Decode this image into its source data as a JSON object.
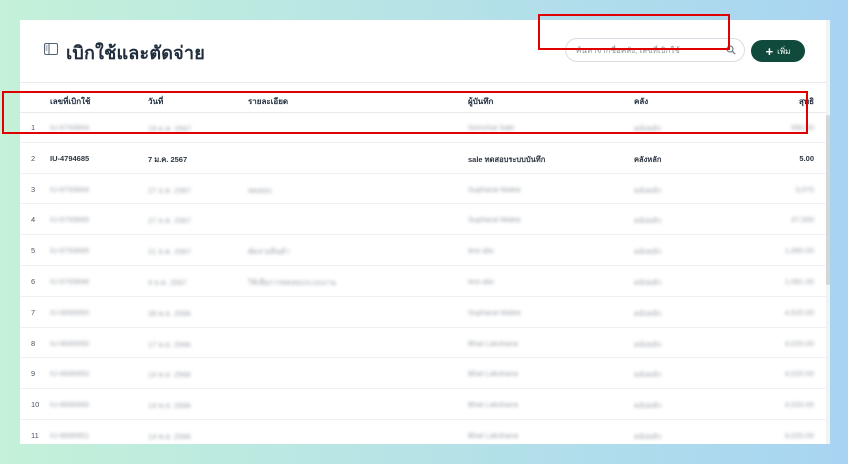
{
  "page": {
    "title": "เบิกใช้และตัดจ่าย",
    "add_label": "เพิ่ม"
  },
  "search": {
    "placeholder": "ค้นหาจากชื่อคลัง, เลขที่เบิกใช้",
    "value": ""
  },
  "table": {
    "columns": [
      "เลขที่เบิกใช้",
      "วันที่",
      "รายละเอียด",
      "ผู้บันทึก",
      "คลัง",
      "สุทธิ"
    ],
    "rows": [
      {
        "num": "1",
        "doc": "IU-6793664",
        "date": "19 ม.ค. 2567",
        "detail": "",
        "recorder": "Somchai Sale",
        "warehouse": "คลังหลัก",
        "net": "990.00"
      },
      {
        "num": "2",
        "doc": "IU-4794685",
        "date": "7 ม.ค. 2567",
        "detail": "",
        "recorder": "sale ทดสอบระบบบันทึก",
        "warehouse": "คลังหลัก",
        "net": "5.00"
      },
      {
        "num": "3",
        "doc": "IU-6793664",
        "date": "27 ธ.ค. 2567",
        "detail": "ทดสอบ",
        "recorder": "Supharat Malee",
        "warehouse": "คลังหลัก",
        "net": "3,070"
      },
      {
        "num": "4",
        "doc": "IU-6793665",
        "date": "27 ธ.ค. 2567",
        "detail": "",
        "recorder": "Supharat Malee",
        "warehouse": "คลังหลัก",
        "net": "37,000"
      },
      {
        "num": "5",
        "doc": "IU-6793665",
        "date": "21 ธ.ค. 2567",
        "detail": "ตัดจ่ายสินค้า",
        "recorder": "test abc",
        "warehouse": "คลังหลัก",
        "net": "1,060.00"
      },
      {
        "num": "6",
        "doc": "IU-6793666",
        "date": "9 ธ.ค. 2567",
        "detail": "ใช้เพื่อการทดสอบระบบงาน",
        "recorder": "test abc",
        "warehouse": "คลังหลัก",
        "net": "1,081.00"
      },
      {
        "num": "7",
        "doc": "IU-6695950",
        "date": "28 พ.ย. 2566",
        "detail": "",
        "recorder": "Supharat Malee",
        "warehouse": "คลังหลัก",
        "net": "4,620.00"
      },
      {
        "num": "8",
        "doc": "IU-6695950",
        "date": "17 พ.ย. 2566",
        "detail": "",
        "recorder": "Bhat Lakshana",
        "warehouse": "คลังหลัก",
        "net": "4,020.00"
      },
      {
        "num": "9",
        "doc": "IU-6695950",
        "date": "14 พ.ย. 2566",
        "detail": "",
        "recorder": "Bhat Lakshana",
        "warehouse": "คลังหลัก",
        "net": "4,020.00"
      },
      {
        "num": "10",
        "doc": "IU-6695950",
        "date": "14 พ.ย. 2566",
        "detail": "",
        "recorder": "Bhat Lakshana",
        "warehouse": "คลังหลัก",
        "net": "4,020.00"
      },
      {
        "num": "11",
        "doc": "IU-6695951",
        "date": "14 พ.ย. 2566",
        "detail": "",
        "recorder": "Bhat Lakshana",
        "warehouse": "คลังหลัก",
        "net": "4,020.00"
      }
    ]
  }
}
